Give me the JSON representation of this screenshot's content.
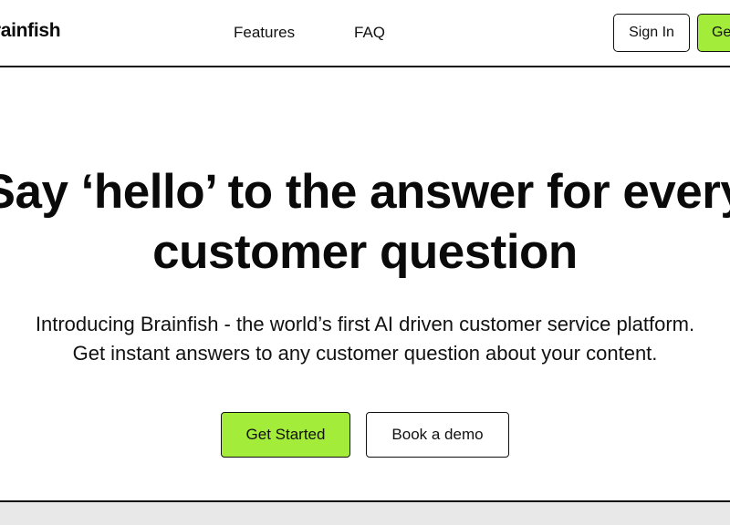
{
  "header": {
    "logo_text": "Brainfish",
    "nav": [
      {
        "label": "Features"
      },
      {
        "label": "FAQ"
      }
    ],
    "sign_in_label": "Sign In",
    "cta_label": "Get Started"
  },
  "hero": {
    "title_lines": [
      "Say ‘hello’ to the answer for every",
      "customer question"
    ],
    "subtitle_lines": [
      "Introducing Brainfish - the world’s first AI driven customer service platform.",
      "Get instant answers to any customer question about your content."
    ],
    "primary_button": "Get Started",
    "secondary_button": "Book a demo"
  },
  "colors": {
    "accent": "#a4ec3a",
    "text": "#0a0a0a",
    "border": "#111111",
    "next_section_bg": "#e8e8e8"
  }
}
